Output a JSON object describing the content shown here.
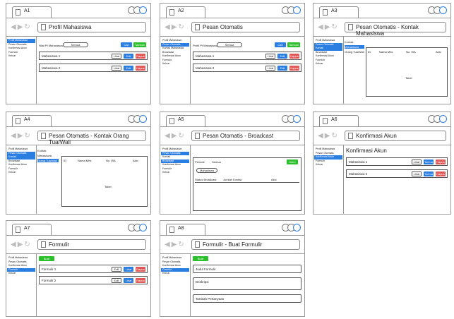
{
  "frames": [
    {
      "tab": "A1",
      "address": "Profil Mahasiswa",
      "sidebar": [
        "Profil Mahasiswa",
        "Pesan Otomatis",
        "Konfirmasi Akun",
        "Formulir",
        "Keluar"
      ],
      "active": 0
    },
    {
      "tab": "A2",
      "address": "Pesan Otomatis",
      "sidebar": [
        "Profil Mahasiswa",
        "Pesan Otomatis",
        "Kontak Mahasiswa",
        "Broadcast",
        "Konfirmasi Akun",
        "Formulir",
        "Keluar"
      ],
      "active": 1
    },
    {
      "tab": "A3",
      "address": "Pesan Otomatis - Kontak Mahasiswa",
      "sidebar": [
        "Profil Mahasiswa",
        "Pesan Otomatis",
        "Kontak",
        "Broadcast",
        "Konfirmasi Akun",
        "Formulir",
        "Keluar"
      ],
      "active": 2
    },
    {
      "tab": "A4",
      "address": "Pesan Otomatis - Kontak Orang Tua/Wali",
      "sidebar": [
        "Profil Mahasiswa",
        "Pesan Otomatis",
        "Kontak",
        "Broadcast",
        "Konfirmasi Akun",
        "Formulir",
        "Keluar"
      ],
      "active": 2
    },
    {
      "tab": "A5",
      "address": "Pesan Otomatis - Broadcast",
      "sidebar": [
        "Profil Mahasiswa",
        "Pesan Otomatis",
        "Kontak",
        "Broadcast",
        "Konfirmasi Akun",
        "Formulir",
        "Keluar"
      ],
      "active": 3
    },
    {
      "tab": "A6",
      "address": "Konfirmasi Akun",
      "sidebar": [
        "Profil Mahasiswa",
        "Pesan Otomatis",
        "Konfirmasi Akun",
        "Formulir",
        "Keluar"
      ],
      "active": 2
    },
    {
      "tab": "A7",
      "address": "Formulir",
      "sidebar": [
        "Profil Mahasiswa",
        "Pesan Otomatis",
        "Konfirmasi Akun",
        "Formulir",
        "Keluar"
      ],
      "active": 3
    },
    {
      "tab": "A8",
      "address": "Formulir - Buat Formulir",
      "sidebar": [
        "Profil Mahasiswa",
        "Pesan Otomatis",
        "Konfirmasi Akun",
        "Formulir",
        "Keluar"
      ],
      "active": 3
    }
  ],
  "a1": {
    "filter_label": "Nilai Pt Mahasiswa",
    "filter_value": "Semua",
    "btn_search": "Cari",
    "btn_add": "Tambah",
    "rows": [
      "Mahasiswa 1",
      "Mahasiswa 2"
    ],
    "row_btns": [
      "Lihat",
      "Edit",
      "Hapus"
    ]
  },
  "a2": {
    "filter_label": "Profil Pt Mahasiswa",
    "filter_value": "Semua",
    "btn_search": "Cari",
    "btn_add": "Tambah",
    "rows": [
      "Mahasiswa 1",
      "Mahasiswa 2"
    ],
    "row_btns": [
      "Lihat",
      "Edit",
      "Hapus"
    ]
  },
  "a3": {
    "sub": [
      "Kontak",
      "Mahasiswa",
      "Orang Tua/Wali"
    ],
    "cols": [
      "ID",
      "Nama Mhs",
      "No. WA",
      "Aksi"
    ],
    "empty": "Tabel"
  },
  "a4": {
    "sub": [
      "Kontak",
      "Mahasiswa",
      "Orang Tua/Wali"
    ],
    "cols": [
      "ID",
      "Nama Mhs",
      "No. WA",
      "Aksi"
    ],
    "empty": "Tabel"
  },
  "a5": {
    "labels": [
      "Periode",
      "Semua"
    ],
    "btn_send": "Kirim",
    "pill": "Mahasiswa",
    "cols": [
      "Status Broadcast",
      "Jumlah Kontak",
      "Aksi"
    ]
  },
  "a6": {
    "title": "Konfirmasi Akun",
    "rows": [
      "Mahasiswa 1",
      "Mahasiswa 2"
    ],
    "row_btns": [
      "Lihat",
      "Terima",
      "Hapus"
    ]
  },
  "a7": {
    "btn_create": "Buat Formulir",
    "rows": [
      "Formulir 1",
      "Formulir 2"
    ],
    "row_btns": [
      "Edit",
      "Lihat",
      "Hapus"
    ]
  },
  "a8": {
    "btn_create": "Buat Formulir",
    "fields": [
      "Judul Formulir",
      "Deskripsi",
      "Tambah Pertanyaan"
    ]
  }
}
